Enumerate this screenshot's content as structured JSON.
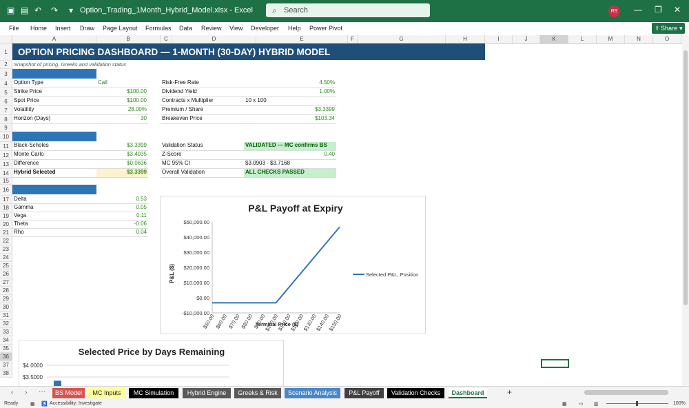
{
  "titlebar": {
    "filename": "Option_Trading_1Month_Hybrid_Model.xlsx",
    "separator": "-",
    "app": "Excel",
    "search_placeholder": "Search",
    "avatar_initials": "RS",
    "icons": [
      "excel-icon",
      "save-icon",
      "undo-icon",
      "redo-icon",
      "customize-icon",
      "minimize-icon",
      "restore-icon",
      "close-icon"
    ]
  },
  "ribbon_tabs": [
    "File",
    "Home",
    "Insert",
    "Draw",
    "Page Layout",
    "Formulas",
    "Data",
    "Review",
    "View",
    "Developer",
    "Help",
    "Power Pivot"
  ],
  "share_label": "Share",
  "columns": [
    "A",
    "B",
    "C",
    "D",
    "E",
    "F",
    "G",
    "H",
    "I",
    "J",
    "K",
    "L",
    "M",
    "N",
    "O"
  ],
  "rows": [
    "1",
    "2",
    "3",
    "4",
    "5",
    "6",
    "7",
    "8",
    "9",
    "10",
    "11",
    "12",
    "13",
    "14",
    "15",
    "16",
    "17",
    "18",
    "19",
    "20",
    "21",
    "22",
    "23",
    "24",
    "25",
    "26",
    "27",
    "28",
    "29",
    "30",
    "31",
    "32",
    "33",
    "34",
    "35",
    "36",
    "37",
    "38"
  ],
  "sheet": {
    "title": "OPTION PRICING DASHBOARD — 1-MONTH (30-DAY) HYBRID MODEL",
    "subtitle": "Snapshot of pricing, Greeks and validation status",
    "inputs": [
      {
        "label": "Option Type",
        "value": "Call"
      },
      {
        "label": "Strike Price",
        "value": "$100.00"
      },
      {
        "label": "Spot Price",
        "value": "$100.00"
      },
      {
        "label": "Volatility",
        "value": "28.00%"
      },
      {
        "label": "Horizon (Days)",
        "value": "30"
      }
    ],
    "market": [
      {
        "label": "Risk-Free Rate",
        "value": "4.50%"
      },
      {
        "label": "Dividend Yield",
        "value": "1.00%"
      },
      {
        "label": "Contracts x Multiplier",
        "value": "10 x 100"
      },
      {
        "label": "Premium / Share",
        "value": "$3.3399"
      },
      {
        "label": "Breakeven Price",
        "value": "$103.34"
      }
    ],
    "pricing": [
      {
        "label": "Black-Scholes",
        "value": "$3.3399"
      },
      {
        "label": "Monte Carlo",
        "value": "$3.4035"
      },
      {
        "label": "Difference",
        "value": "$0.0636"
      },
      {
        "label": "Hybrid Selected",
        "value": "$3.3399"
      }
    ],
    "validation": [
      {
        "label": "Validation Status",
        "value": "VALIDATED — MC confirms BS"
      },
      {
        "label": "Z-Score",
        "value": "0.40"
      },
      {
        "label": "MC 95% CI",
        "value": "$3.0903 - $3.7168"
      },
      {
        "label": "Overall Validation",
        "value": "ALL CHECKS PASSED"
      }
    ],
    "greeks": [
      {
        "label": "Delta",
        "value": "0.53"
      },
      {
        "label": "Gamma",
        "value": "0.05"
      },
      {
        "label": "Vega",
        "value": "0.11"
      },
      {
        "label": "Theta",
        "value": "-0.06"
      },
      {
        "label": "Rho",
        "value": "0.04"
      }
    ]
  },
  "chart_data": [
    {
      "type": "line",
      "title": "P&L Payoff at Expiry",
      "xlabel": "Terminal Price ($)",
      "ylabel": "P&L ($)",
      "categories": [
        "$50.00",
        "$60.00",
        "$70.00",
        "$80.00",
        "$90.00",
        "$100.00",
        "$110.00",
        "$120.00",
        "$130.00",
        "$140.00",
        "$150.00"
      ],
      "yticks": [
        "$50,000.00",
        "$40,000.00",
        "$30,000.00",
        "$20,000.00",
        "$10,000.00",
        "$0.00",
        "-$10,000.00"
      ],
      "ylim": [
        -10000,
        50000
      ],
      "series": [
        {
          "name": "Selected P&L, Position",
          "color": "#2e75b6",
          "values": [
            -3340,
            -3340,
            -3340,
            -3340,
            -3340,
            -3340,
            6660,
            16660,
            26660,
            36660,
            46660
          ]
        }
      ],
      "legend": "right"
    },
    {
      "type": "bar",
      "title": "Selected Price by Days Remaining",
      "yticks": [
        "$4.0000",
        "$3.5000"
      ],
      "ylim": [
        3.0,
        4.0
      ],
      "series": [
        {
          "values": [
            3.34
          ]
        }
      ],
      "color": "#2e75b6"
    }
  ],
  "tabs": [
    {
      "label": "BS Model",
      "bg": "#d9534f",
      "fg": "#ffffff"
    },
    {
      "label": "MC Inputs",
      "bg": "#ffff99",
      "fg": "#222222"
    },
    {
      "label": "MC Simulation",
      "bg": "#000000",
      "fg": "#ffffff"
    },
    {
      "label": "Hybrid Engine",
      "bg": "#595959",
      "fg": "#ffffff"
    },
    {
      "label": "Greeks & Risk",
      "bg": "#595959",
      "fg": "#ffffff"
    },
    {
      "label": "Scenario Analysis",
      "bg": "#4a86c8",
      "fg": "#ffffff"
    },
    {
      "label": "P&L Payoff",
      "bg": "#404040",
      "fg": "#ffffff"
    },
    {
      "label": "Validation Checks",
      "bg": "#000000",
      "fg": "#ffffff"
    },
    {
      "label": "Dashboard",
      "bg": "#ffffff",
      "fg": "#1e7145"
    }
  ],
  "status": {
    "ready": "Ready",
    "accessibility": "Accessibility: Investigate",
    "zoom": "100%"
  }
}
